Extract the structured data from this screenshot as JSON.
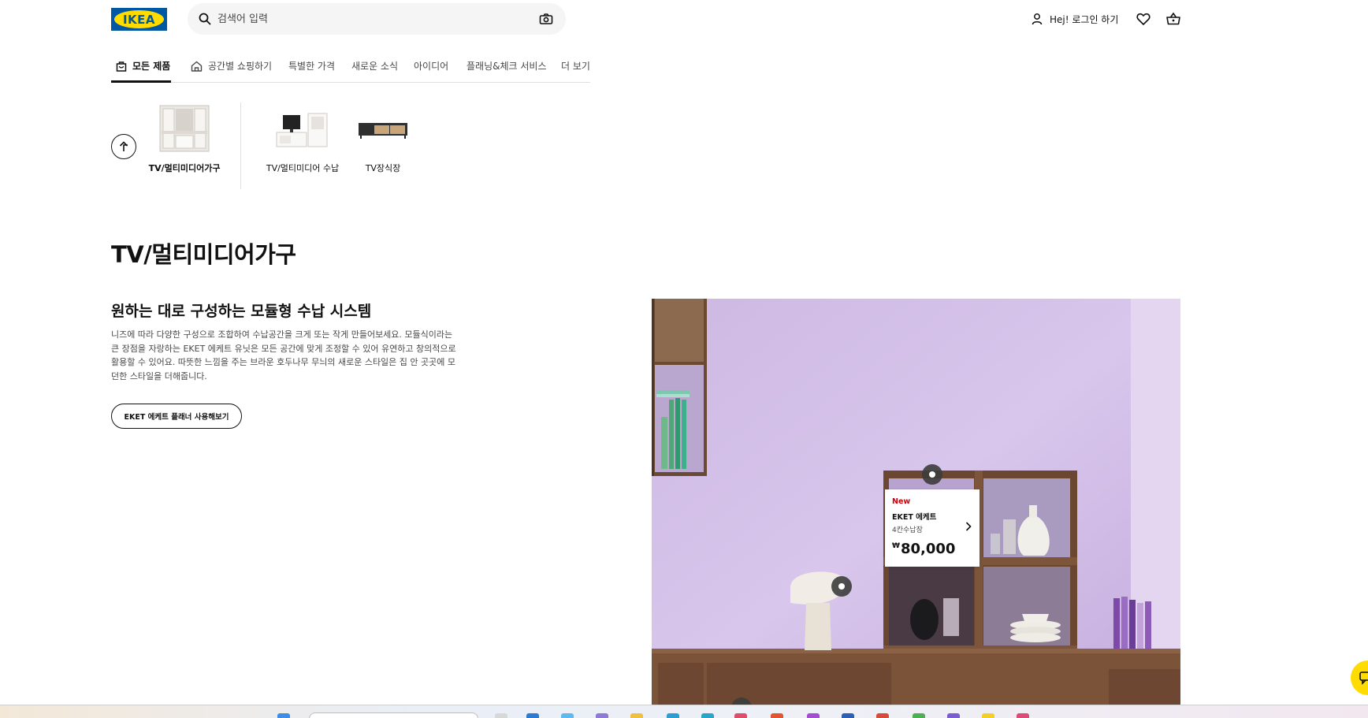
{
  "header": {
    "logo_text": "IKEA",
    "search_placeholder": "검색어 입력",
    "login_label": "Hej! 로그인 하기"
  },
  "nav": {
    "items": [
      {
        "label": "모든 제품",
        "active": true
      },
      {
        "label": "공간별 쇼핑하기"
      },
      {
        "label": "특별한 가격"
      },
      {
        "label": "새로운 소식"
      },
      {
        "label": "아이디어"
      },
      {
        "label": "플래닝&체크 서비스"
      },
      {
        "label": "더 보기"
      }
    ]
  },
  "categories": [
    {
      "label": "TV/멀티미디어가구",
      "selected": true
    },
    {
      "label": "TV/멀티미디어 수납"
    },
    {
      "label": "TV장식장"
    }
  ],
  "main": {
    "title": "TV/멀티미디어가구",
    "section_title": "원하는 대로 구성하는 모듈형 수납 시스템",
    "section_desc": "니즈에 따라 다양한 구성으로 조합하여 수납공간을 크게 또는 작게 만들어보세요. 모듈식이라는 큰 장점을 자랑하는 EKET 에케트 유닛은 모든 공간에 맞게 조정할 수 있어 유연하고 창의적으로 활용할 수 있어요. 따뜻한 느낌을 주는 브라운 호두나무 무늬의 새로운 스타일은 집 안 곳곳에 모던한 스타일을 더해줍니다.",
    "planner_button": "EKET 에케트 플래너 사용해보기"
  },
  "product_card": {
    "badge": "New",
    "name": "EKET 에케트",
    "description": "4칸수납장",
    "currency": "₩",
    "price": "80,000"
  },
  "colors": {
    "ikea_blue": "#0058a3",
    "ikea_yellow": "#ffdb00",
    "new_badge": "#cc0008",
    "wall_lilac": "#d9c6ea"
  }
}
